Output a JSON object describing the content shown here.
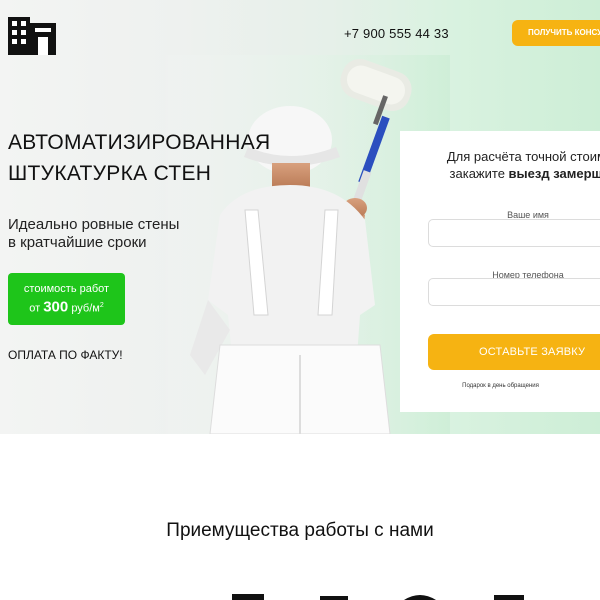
{
  "header": {
    "phone": "+7 900 555 44 33",
    "consult_label": "ПОЛУЧИТЬ КОНСУ"
  },
  "hero": {
    "title_line1": "АВТОМАТИЗИРОВАННАЯ",
    "title_line2": "ШТУКАТУРКА СТЕН",
    "subtitle_line1": "Идеально ровные стены",
    "subtitle_line2": "в кратчайшие сроки",
    "price": {
      "line1": "стоимость работ",
      "prefix": "от",
      "amount": "300",
      "unit": "руб/м",
      "unit_sup": "2"
    },
    "payment_note": "ОПЛАТА ПО ФАКТУ!"
  },
  "form": {
    "heading_line1": "Для расчёта точной стоимо",
    "heading_line2_prefix": "закажите ",
    "heading_line2_bold": "выезд замерщи",
    "name_label": "Ваше имя",
    "name_value": "",
    "phone_label": "Номер телефона",
    "phone_value": "",
    "submit_label": "ОСТАВЬТЕ ЗАЯВКУ",
    "gift_note": "Подарок в день обращения"
  },
  "advantages": {
    "title": "Приемущества работы с нами"
  },
  "colors": {
    "accent_orange": "#f6b312",
    "accent_green": "#1ec51a",
    "text_dark": "#111111"
  },
  "icons": {
    "logo": "building-logo-icon"
  }
}
